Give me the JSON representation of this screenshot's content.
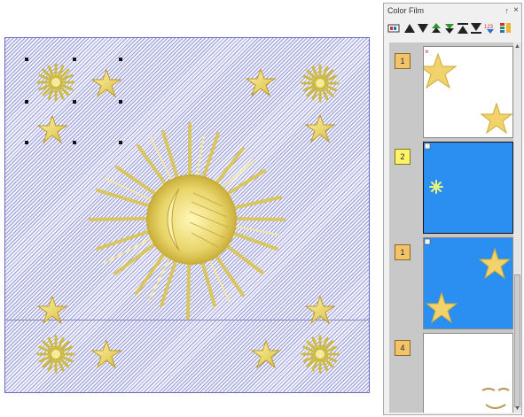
{
  "panel": {
    "title": "Color Film",
    "pin_glyph": "↑",
    "close_glyph": "×",
    "toolbar": [
      {
        "icon": "film-view-icon"
      },
      {
        "icon": "move-up-icon"
      },
      {
        "icon": "move-down-icon"
      },
      {
        "icon": "move-up-one-icon"
      },
      {
        "icon": "move-down-one-icon"
      },
      {
        "icon": "move-to-top-icon"
      },
      {
        "icon": "move-to-bottom-icon"
      },
      {
        "icon": "sequence-numbers-icon",
        "label": "123"
      },
      {
        "icon": "color-blocks-icon"
      }
    ],
    "frames": [
      {
        "number": "1",
        "thumb": "white",
        "badge_color": "orange"
      },
      {
        "number": "2",
        "thumb": "blue",
        "badge_color": "yellow"
      },
      {
        "number": "1",
        "thumb": "blue",
        "badge_color": "orange"
      },
      {
        "number": "4",
        "thumb": "white",
        "badge_color": "orange"
      }
    ],
    "scroll_up_glyph": "▲",
    "scroll_down_glyph": "▼"
  },
  "canvas": {
    "design": "sun-and-stars-embroidery",
    "thread_color": "#e8d66a",
    "fabric_stitch_color": "#9a9ad8"
  }
}
